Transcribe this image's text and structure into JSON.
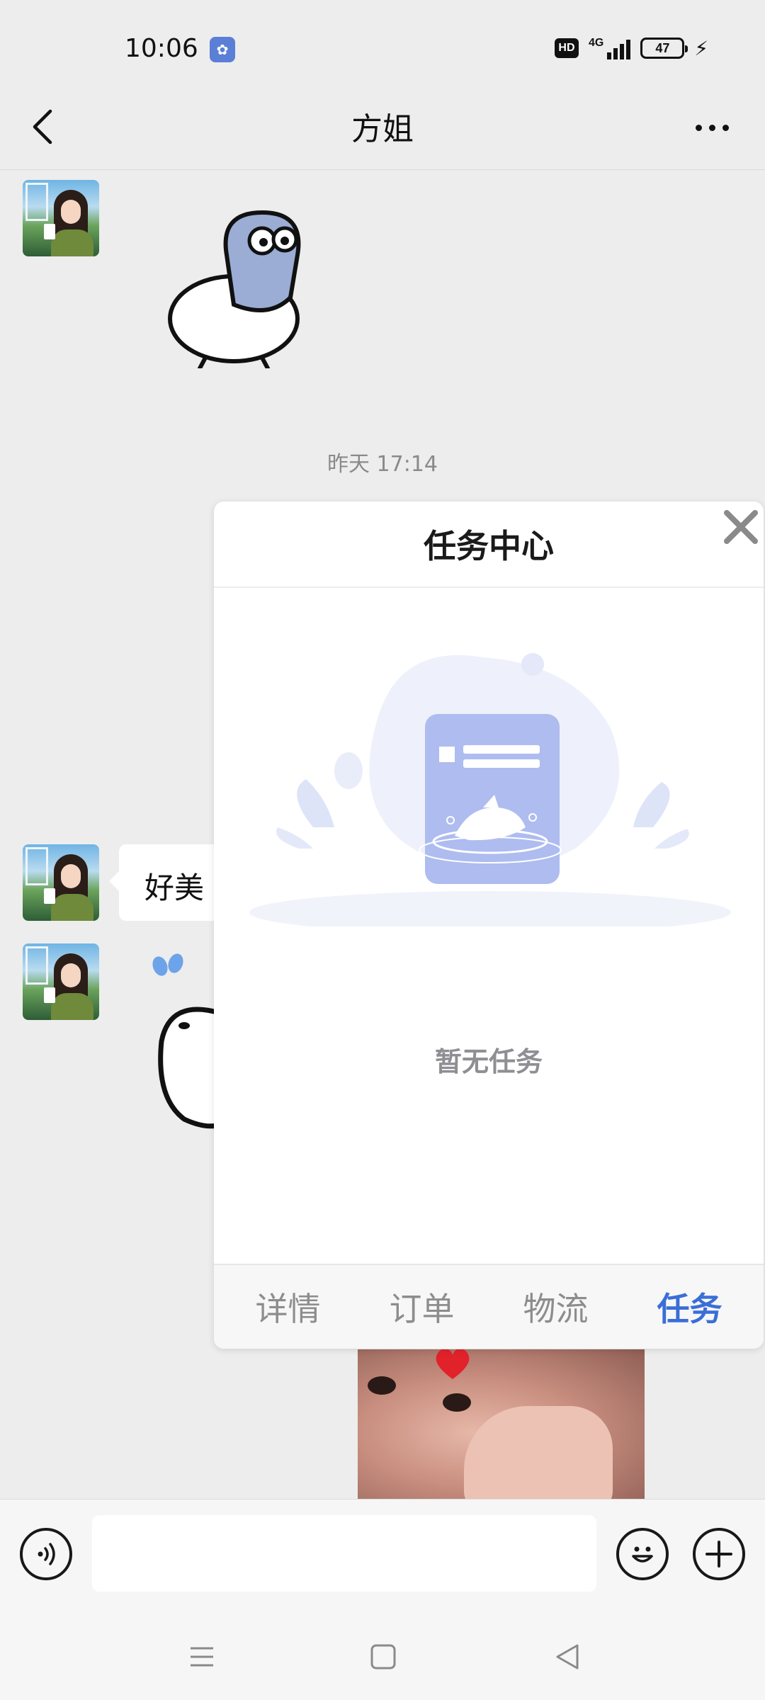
{
  "status_bar": {
    "time": "10:06",
    "hd_label": "HD",
    "network_label": "4G",
    "battery_level": "47"
  },
  "header": {
    "title": "方姐"
  },
  "chat": {
    "timestamp": "昨天 17:14",
    "message_text": "好美"
  },
  "task_center": {
    "title": "任务中心",
    "empty_text": "暂无任务",
    "tabs": [
      {
        "label": "详情"
      },
      {
        "label": "订单"
      },
      {
        "label": "物流"
      },
      {
        "label": "任务"
      }
    ],
    "active_tab": "任务",
    "accent_color": "#3a6ed8"
  },
  "icons": {
    "back": "back-arrow-icon",
    "more": "more-dots-icon",
    "voice": "voice-icon",
    "emoji": "emoji-icon",
    "add": "plus-icon",
    "close": "close-icon"
  }
}
